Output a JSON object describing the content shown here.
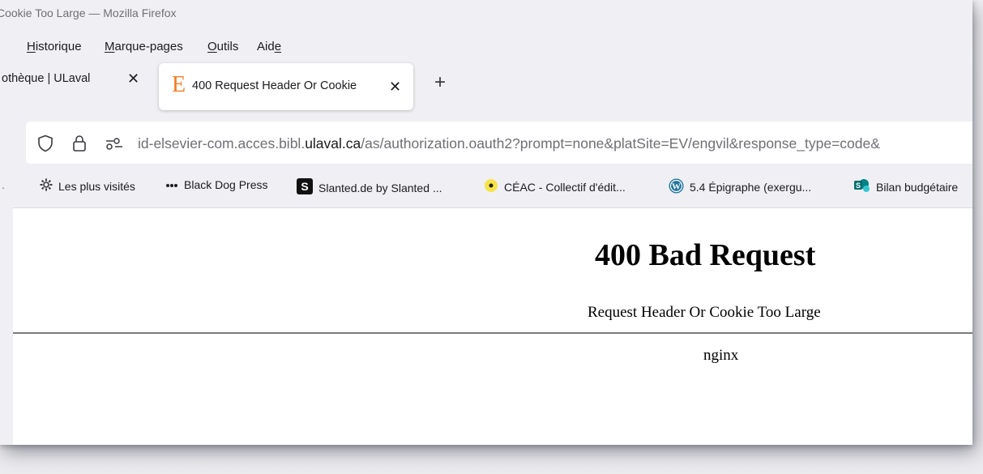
{
  "window": {
    "title": "Cookie Too Large — Mozilla Firefox"
  },
  "menu": {
    "items": [
      {
        "label": "Historique",
        "accel": "H"
      },
      {
        "label": "Marque-pages",
        "accel": "M"
      },
      {
        "label": "Outils",
        "accel": "O"
      },
      {
        "label": "Aide",
        "accel": "e"
      }
    ]
  },
  "tabs": [
    {
      "label": "othèque | ULaval",
      "active": false
    },
    {
      "label": "400 Request Header Or Cookie",
      "active": true,
      "favicon_letter": "E"
    }
  ],
  "address": {
    "url_prefix": "id-elsevier-com.acces.bibl.",
    "url_host": "ulaval.ca",
    "url_suffix": "/as/authorization.oauth2?prompt=none&platSite=EV/engvil&response_type=code&"
  },
  "bookmarks": [
    {
      "label": "Les plus visités",
      "icon": "gear-icon"
    },
    {
      "label": "Black Dog Press",
      "icon": "dots-icon"
    },
    {
      "label": "Slanted.de by Slanted ...",
      "icon": "slanted-icon"
    },
    {
      "label": "CÉAC - Collectif d'édit...",
      "icon": "yellow-dot-icon"
    },
    {
      "label": "5.4 Épigraphe (exergu...",
      "icon": "wordpress-icon"
    },
    {
      "label": "Bilan budgétaire",
      "icon": "sharepoint-icon"
    }
  ],
  "page": {
    "heading": "400 Bad Request",
    "message": "Request Header Or Cookie Too Large",
    "server": "nginx"
  },
  "colors": {
    "accent_favicon": "#f07c25",
    "url_muted": "#6f6f74"
  }
}
